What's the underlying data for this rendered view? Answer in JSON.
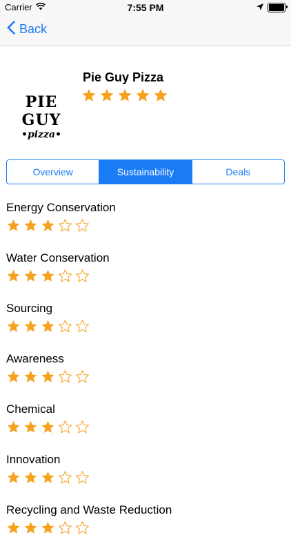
{
  "status_bar": {
    "carrier": "Carrier",
    "time": "7:55 PM"
  },
  "nav": {
    "back_label": "Back"
  },
  "restaurant": {
    "name": "Pie Guy Pizza",
    "logo_line1": "PIE GUY",
    "logo_line2": "•pizza•",
    "rating": 5
  },
  "tabs": [
    {
      "label": "Overview",
      "active": false
    },
    {
      "label": "Sustainability",
      "active": true
    },
    {
      "label": "Deals",
      "active": false
    }
  ],
  "ratings": [
    {
      "label": "Energy Conservation",
      "stars": 3
    },
    {
      "label": "Water Conservation",
      "stars": 3
    },
    {
      "label": "Sourcing",
      "stars": 3
    },
    {
      "label": "Awareness",
      "stars": 3
    },
    {
      "label": "Chemical",
      "stars": 3
    },
    {
      "label": "Innovation",
      "stars": 3
    },
    {
      "label": "Recycling and Waste Reduction",
      "stars": 3
    }
  ],
  "star_max": 5,
  "colors": {
    "accent": "#1a7cf5",
    "star": "#f6a21e"
  }
}
